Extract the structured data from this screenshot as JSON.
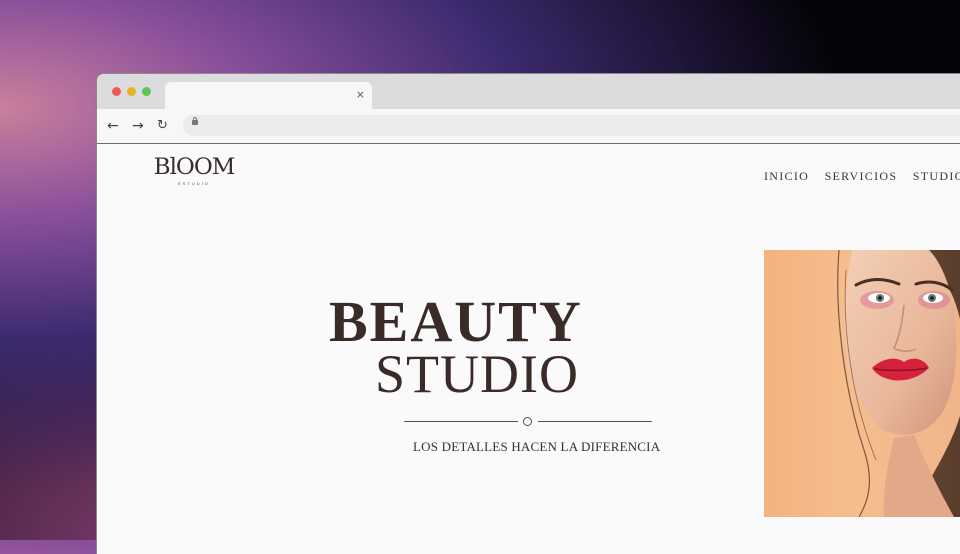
{
  "browser": {
    "tab": {
      "close_glyph": "×"
    },
    "toolbar": {
      "back_glyph": "←",
      "forward_glyph": "→",
      "reload_glyph": "↻"
    }
  },
  "site": {
    "logo": {
      "word": "BlOOM",
      "sub": "ESTUDIO"
    },
    "nav": [
      "INICIO",
      "SERVICIOS",
      "STUDIO"
    ],
    "hero": {
      "title_line1": "BEAUTY",
      "title_line2": "STUDIO",
      "tagline": "LOS DETALLES HACEN LA DIFERENCIA"
    }
  }
}
